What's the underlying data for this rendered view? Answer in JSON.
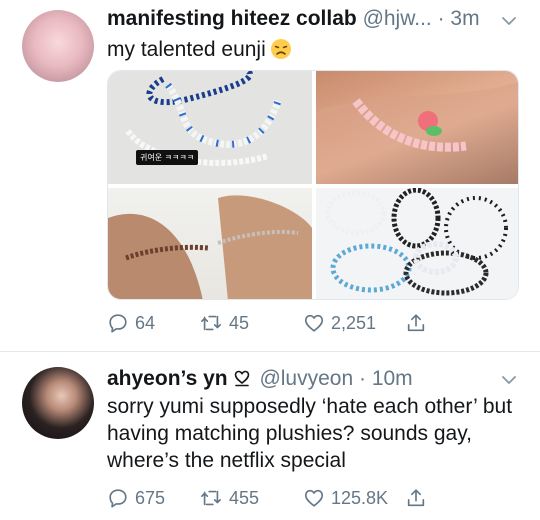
{
  "tweets": [
    {
      "name": "manifesting hiteez collab",
      "handle": "@hjw...",
      "time": "3m",
      "text": "my talented eunji",
      "emoji": "disappointed-face",
      "media_caption": "귀여운 ㅋㅋㅋㅋ",
      "counts": {
        "replies": "64",
        "retweets": "45",
        "likes": "2,251"
      }
    },
    {
      "name": "ahyeon’s yn",
      "handle": "@luvyeon",
      "time": "10m",
      "text": "sorry yumi supposedly ‘hate each other’ but having matching plushies? sounds gay, where’s the netflix special",
      "counts": {
        "replies": "675",
        "retweets": "455",
        "likes": "125.8K"
      }
    }
  ],
  "colors": {
    "text": "#14171a",
    "muted": "#657786",
    "divider": "#e1e8ed"
  }
}
